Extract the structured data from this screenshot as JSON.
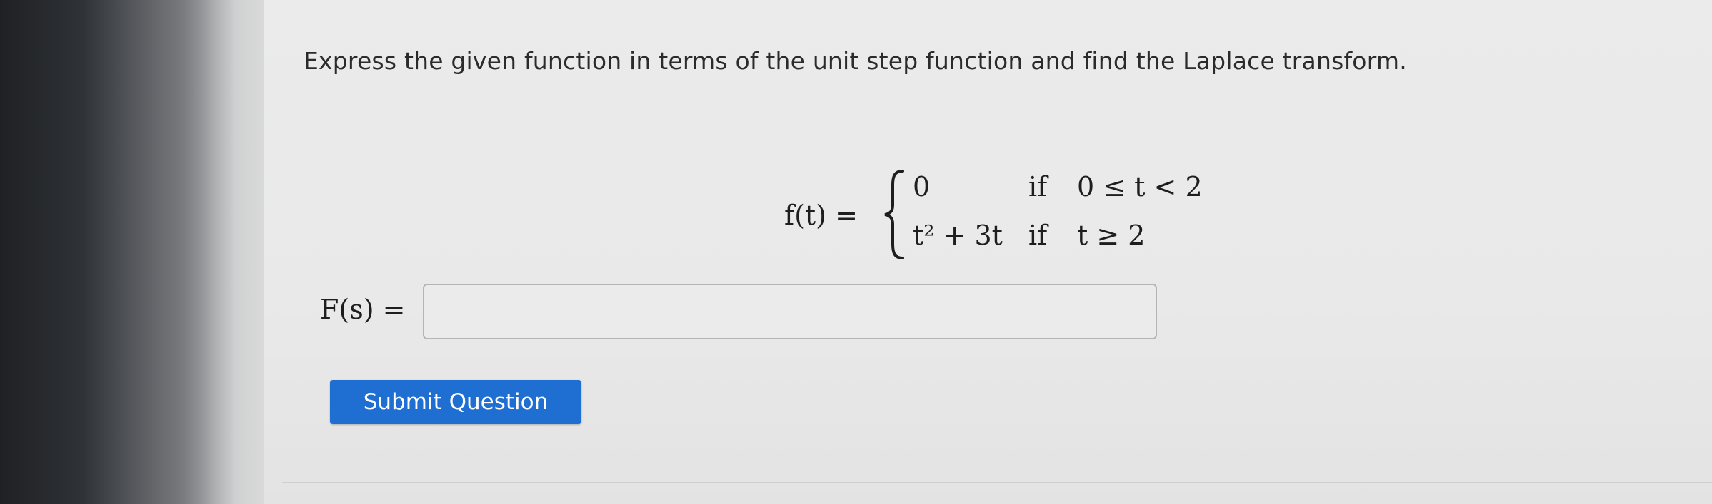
{
  "question": {
    "text": "Express the given function in terms of the unit step function and find the Laplace transform."
  },
  "function_def": {
    "label": "f(t) =",
    "cases": [
      {
        "expr": "0",
        "keyword": "if",
        "condition": "0 ≤ t < 2"
      },
      {
        "expr": "t² + 3t",
        "keyword": "if",
        "condition": "t ≥ 2"
      }
    ]
  },
  "answer": {
    "label": "F(s) =",
    "value": "",
    "placeholder": ""
  },
  "submit": {
    "label": "Submit Question"
  },
  "colors": {
    "button_bg": "#1f6fd2",
    "button_text": "#ffffff",
    "page_bg": "#ebebeb",
    "input_border": "#b5b5b5"
  }
}
